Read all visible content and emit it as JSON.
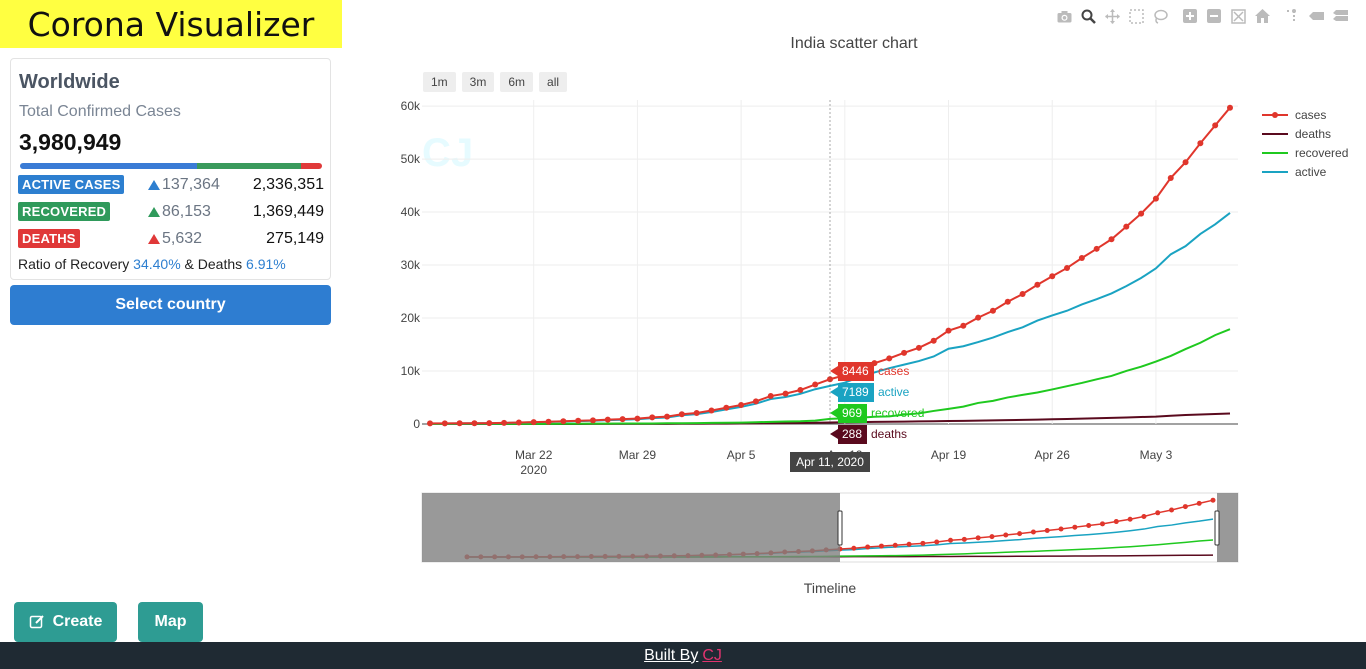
{
  "brand": {
    "title": "Corona Visualizer"
  },
  "worldwide": {
    "title": "Worldwide",
    "subtitle": "Total Confirmed Cases",
    "total": "3,980,949",
    "progress": {
      "active": 0.587,
      "recovered": 0.344,
      "deaths": 0.069
    },
    "rows": [
      {
        "label": "ACTIVE CASES",
        "delta": "137,364",
        "value": "2,336,351"
      },
      {
        "label": "RECOVERED",
        "delta": "86,153",
        "value": "1,369,449"
      },
      {
        "label": "DEATHS",
        "delta": "5,632",
        "value": "275,149"
      }
    ],
    "ratio": {
      "prefix": "Ratio of Recovery",
      "recovery": "34.40%",
      "middle": "& Deaths",
      "deaths": "6.91%"
    }
  },
  "select_country_label": "Select country",
  "buttons": {
    "create": "Create",
    "map": "Map"
  },
  "footer": {
    "built": "Built By",
    "author": "CJ"
  },
  "modebar": [
    "camera-icon",
    "zoom-icon",
    "pan-icon",
    "box-select-icon",
    "lasso-icon",
    "zoom-in-icon",
    "zoom-out-icon",
    "autoscale-icon",
    "home-icon",
    "spike-lines-icon",
    "hover-closest-icon",
    "hover-compare-icon"
  ],
  "chart": {
    "range_buttons": [
      "1m",
      "3m",
      "6m",
      "all"
    ],
    "watermark": "CJ",
    "hover": {
      "date": "Apr 11, 2020",
      "labels": [
        {
          "value": "8446",
          "name": "cases",
          "color": "#e0362c"
        },
        {
          "value": "7189",
          "name": "active",
          "color": "#1aa3c2"
        },
        {
          "value": "969",
          "name": "recovered",
          "color": "#1fc91f"
        },
        {
          "value": "288",
          "name": "deaths",
          "color": "#5a0a1e"
        }
      ]
    },
    "slider_label": "Timeline"
  },
  "chart_data": {
    "type": "line",
    "title": "India scatter chart",
    "x_ticks": [
      "Mar 22\n2020",
      "Mar 29",
      "Apr 5",
      "Apr 12",
      "Apr 19",
      "Apr 26",
      "May 3"
    ],
    "y_ticks": [
      "0",
      "10k",
      "20k",
      "30k",
      "40k",
      "50k",
      "60k"
    ],
    "ylim": [
      0,
      62000
    ],
    "x": [
      "2020-03-15",
      "2020-03-16",
      "2020-03-17",
      "2020-03-18",
      "2020-03-19",
      "2020-03-20",
      "2020-03-21",
      "2020-03-22",
      "2020-03-23",
      "2020-03-24",
      "2020-03-25",
      "2020-03-26",
      "2020-03-27",
      "2020-03-28",
      "2020-03-29",
      "2020-03-30",
      "2020-03-31",
      "2020-04-01",
      "2020-04-02",
      "2020-04-03",
      "2020-04-04",
      "2020-04-05",
      "2020-04-06",
      "2020-04-07",
      "2020-04-08",
      "2020-04-09",
      "2020-04-10",
      "2020-04-11",
      "2020-04-12",
      "2020-04-13",
      "2020-04-14",
      "2020-04-15",
      "2020-04-16",
      "2020-04-17",
      "2020-04-18",
      "2020-04-19",
      "2020-04-20",
      "2020-04-21",
      "2020-04-22",
      "2020-04-23",
      "2020-04-24",
      "2020-04-25",
      "2020-04-26",
      "2020-04-27",
      "2020-04-28",
      "2020-04-29",
      "2020-04-30",
      "2020-05-01",
      "2020-05-02",
      "2020-05-03",
      "2020-05-04",
      "2020-05-05",
      "2020-05-06",
      "2020-05-07",
      "2020-05-08"
    ],
    "series": [
      {
        "name": "cases",
        "color": "#e0362c",
        "markers": true,
        "values": [
          107,
          114,
          137,
          151,
          173,
          223,
          283,
          360,
          434,
          519,
          606,
          694,
          834,
          918,
          1024,
          1251,
          1397,
          1834,
          2069,
          2547,
          3072,
          3588,
          4281,
          5274,
          5734,
          6412,
          7447,
          8446,
          9205,
          10453,
          11487,
          12380,
          13430,
          14378,
          15722,
          17615,
          18539,
          20080,
          21370,
          23077,
          24530,
          26283,
          27890,
          29451,
          31324,
          33062,
          34863,
          37257,
          39699,
          42533,
          46437,
          49400,
          52987,
          56351,
          59695
        ]
      },
      {
        "name": "deaths",
        "color": "#5a0a1e",
        "markers": false,
        "values": [
          2,
          2,
          3,
          3,
          4,
          4,
          4,
          7,
          9,
          10,
          10,
          16,
          20,
          24,
          27,
          32,
          35,
          41,
          58,
          72,
          75,
          99,
          118,
          149,
          166,
          199,
          239,
          288,
          331,
          358,
          393,
          420,
          452,
          486,
          521,
          559,
          592,
          645,
          681,
          721,
          780,
          825,
          886,
          939,
          1007,
          1075,
          1152,
          1223,
          1323,
          1389,
          1568,
          1694,
          1783,
          1889,
          1981
        ]
      },
      {
        "name": "recovered",
        "color": "#1fc91f",
        "markers": false,
        "values": [
          9,
          10,
          14,
          14,
          20,
          23,
          23,
          23,
          35,
          40,
          43,
          66,
          75,
          84,
          95,
          102,
          144,
          144,
          156,
          212,
          229,
          271,
          326,
          411,
          473,
          516,
          643,
          969,
          1080,
          1181,
          1359,
          1432,
          1768,
          2014,
          2463,
          2854,
          3273,
          3975,
          4370,
          5012,
          5498,
          5939,
          6523,
          7137,
          7747,
          8437,
          9068,
          10007,
          10819,
          11775,
          12849,
          14142,
          15331,
          16776,
          17887
        ]
      },
      {
        "name": "active",
        "color": "#1aa3c2",
        "markers": false,
        "values": [
          96,
          102,
          120,
          134,
          149,
          196,
          256,
          330,
          390,
          469,
          553,
          612,
          739,
          810,
          902,
          1117,
          1218,
          1649,
          1855,
          2263,
          2768,
          3218,
          3837,
          4714,
          5095,
          5697,
          6565,
          7189,
          7794,
          8914,
          9735,
          10528,
          11210,
          11878,
          12738,
          14202,
          14674,
          15460,
          16319,
          17344,
          18252,
          19519,
          20481,
          21375,
          22570,
          23550,
          24643,
          26027,
          27557,
          29369,
          32020,
          33564,
          35873,
          37686,
          39827
        ]
      }
    ],
    "range_slider": true,
    "range_slider_window": [
      "2020-03-15",
      "2020-05-08"
    ],
    "x_axis_label": "Timeline"
  }
}
